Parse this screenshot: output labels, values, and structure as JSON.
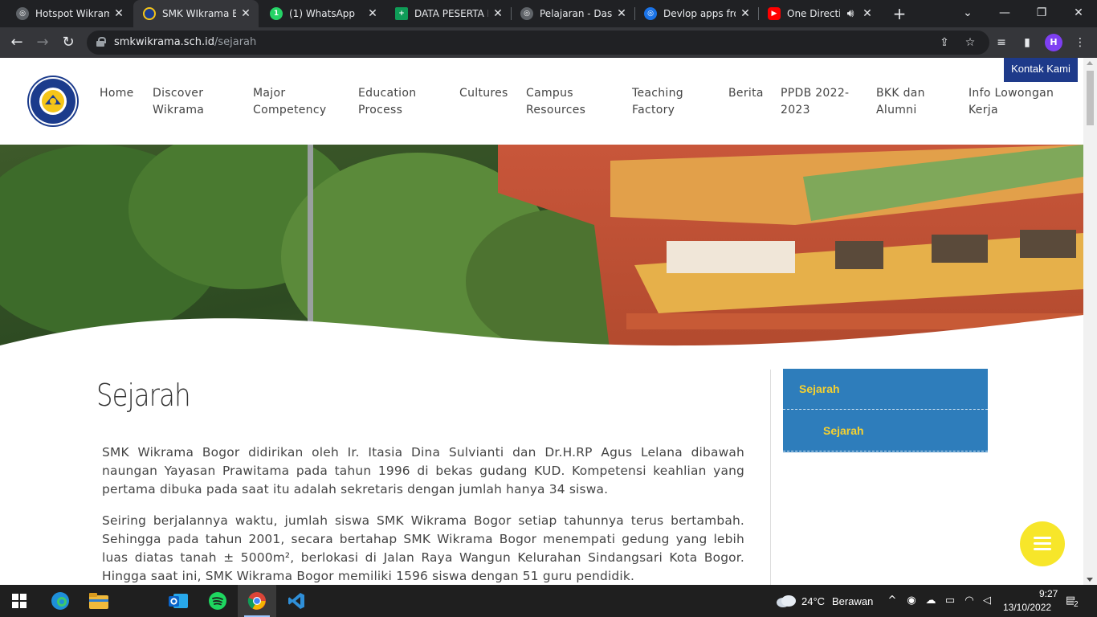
{
  "browser": {
    "tabs": [
      {
        "title": "Hotspot Wikrama",
        "icon": "globe-icon"
      },
      {
        "title": "SMK WIkrama Bo",
        "icon": "smk-wikrama-favicon"
      },
      {
        "title": "(1) WhatsApp",
        "icon": "whatsapp-icon"
      },
      {
        "title": "DATA PESERTA D",
        "icon": "google-sheets-icon"
      },
      {
        "title": "Pelajaran - Dasar",
        "icon": "globe-icon"
      },
      {
        "title": "Devlop apps fron",
        "icon": "globe-icon"
      },
      {
        "title": "One Directio",
        "icon": "youtube-icon"
      }
    ],
    "whatsapp_badge": "1",
    "url_domain": "smkwikrama.sch.id",
    "url_path": "/sejarah",
    "profile_initial": "H"
  },
  "site": {
    "contact_label": "Kontak Kami",
    "nav": [
      "Home",
      "Discover Wikrama",
      "Major Competency",
      "Education Process",
      "Cultures",
      "Campus Resources",
      "Teaching Factory",
      "Berita",
      "PPDB 2022-2023",
      "BKK dan Alumni",
      "Info Lowongan Kerja"
    ],
    "logo_top_text": "SMK WIKRAMA",
    "logo_bottom_text": "KOTA BOGOR",
    "page_title": "Sejarah",
    "paragraphs": [
      "SMK Wikrama Bogor didirikan oleh Ir. Itasia Dina Sulvianti dan Dr.H.RP Agus Lelana dibawah naungan Yayasan Prawitama pada tahun 1996 di bekas gudang KUD. Kompetensi keahlian yang pertama dibuka pada saat itu adalah sekretaris dengan jumlah hanya 34 siswa.",
      "Seiring berjalannya waktu, jumlah siswa SMK Wikrama Bogor setiap tahunnya terus bertambah. Sehingga pada tahun 2001, secara bertahap SMK Wikrama Bogor menempati gedung yang lebih luas diatas tanah ± 5000m², berlokasi di Jalan Raya Wangun Kelurahan Sindangsari Kota Bogor. Hingga saat ini, SMK Wikrama Bogor  memiliki 1596 siswa dengan 51 guru pendidik."
    ],
    "sidebar_heading": "Sejarah",
    "sidebar_items": [
      "Sejarah"
    ],
    "colors": {
      "brand_blue": "#1e3a8a",
      "sidebar_blue": "#2e7dbb",
      "sidebar_text": "#f5d130",
      "fab": "#f7e62a"
    }
  },
  "taskbar": {
    "weather_temp": "24°C",
    "weather_text": "Berawan",
    "time": "9:27",
    "date": "13/10/2022",
    "notification_count": "2"
  }
}
